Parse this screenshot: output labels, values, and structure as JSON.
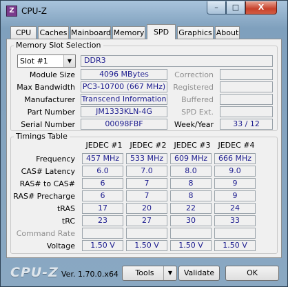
{
  "window": {
    "title": "CPU-Z",
    "icon": "cpuz-app-icon",
    "min": "–",
    "max": "□",
    "close": "X"
  },
  "tabs": [
    "CPU",
    "Caches",
    "Mainboard",
    "Memory",
    "SPD",
    "Graphics",
    "About"
  ],
  "active_tab": "SPD",
  "memory_slot": {
    "group_title": "Memory Slot Selection",
    "slot": "Slot #1",
    "type": "DDR3",
    "module_size_label": "Module Size",
    "module_size": "4096 MBytes",
    "max_bandwidth_label": "Max Bandwidth",
    "max_bandwidth": "PC3-10700 (667 MHz)",
    "manufacturer_label": "Manufacturer",
    "manufacturer": "Transcend Information",
    "part_number_label": "Part Number",
    "part_number": "JM1333KLN-4G",
    "serial_number_label": "Serial Number",
    "serial_number": "00098FBF",
    "correction_label": "Correction",
    "registered_label": "Registered",
    "buffered_label": "Buffered",
    "spd_ext_label": "SPD Ext.",
    "week_year_label": "Week/Year",
    "week_year": "33 / 12"
  },
  "timings": {
    "group_title": "Timings Table",
    "columns": [
      "JEDEC #1",
      "JEDEC #2",
      "JEDEC #3",
      "JEDEC #4"
    ],
    "rows": [
      {
        "label": "Frequency",
        "values": [
          "457 MHz",
          "533 MHz",
          "609 MHz",
          "666 MHz"
        ],
        "disabled": false
      },
      {
        "label": "CAS# Latency",
        "values": [
          "6.0",
          "7.0",
          "8.0",
          "9.0"
        ],
        "disabled": false
      },
      {
        "label": "RAS# to CAS#",
        "values": [
          "6",
          "7",
          "8",
          "9"
        ],
        "disabled": false
      },
      {
        "label": "RAS# Precharge",
        "values": [
          "6",
          "7",
          "8",
          "9"
        ],
        "disabled": false
      },
      {
        "label": "tRAS",
        "values": [
          "17",
          "20",
          "22",
          "24"
        ],
        "disabled": false
      },
      {
        "label": "tRC",
        "values": [
          "23",
          "27",
          "30",
          "33"
        ],
        "disabled": false
      },
      {
        "label": "Command Rate",
        "values": [
          "",
          "",
          "",
          ""
        ],
        "disabled": true
      },
      {
        "label": "Voltage",
        "values": [
          "1.50 V",
          "1.50 V",
          "1.50 V",
          "1.50 V"
        ],
        "disabled": false
      }
    ]
  },
  "footer": {
    "logo": "CPU-Z",
    "version": "Ver. 1.70.0.x64",
    "tools_label": "Tools",
    "validate_label": "Validate",
    "ok_label": "OK"
  },
  "icons": {
    "dropdown": "▼"
  }
}
